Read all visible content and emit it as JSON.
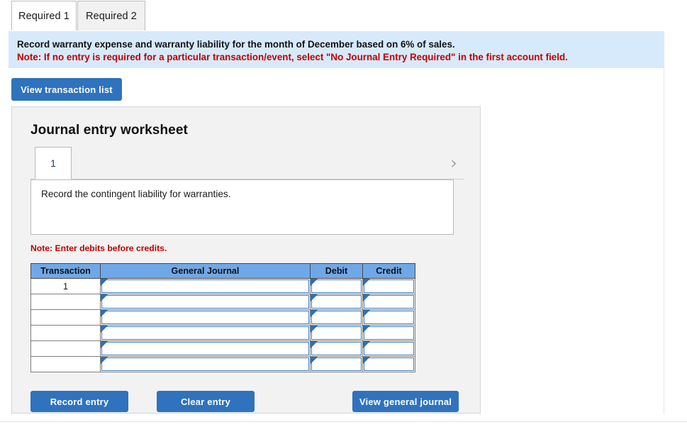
{
  "tabs": [
    {
      "label": "Required 1",
      "active": true
    },
    {
      "label": "Required 2",
      "active": false
    }
  ],
  "banner": {
    "instruction": "Record warranty expense and warranty liability for the month of December based on 6% of sales.",
    "note": "Note: If no entry is required for a particular transaction/event, select \"No Journal Entry Required\" in the first account field."
  },
  "toolbar": {
    "view_transaction_list_label": "View transaction list"
  },
  "worksheet": {
    "title": "Journal entry worksheet",
    "prev_icon": "chevron-left-icon",
    "next_icon": "chevron-right-icon",
    "pages": [
      {
        "label": "1",
        "active": true
      }
    ],
    "description": "Record the contingent liability for warranties.",
    "note": "Note: Enter debits before credits.",
    "table": {
      "headers": [
        "Transaction",
        "General Journal",
        "Debit",
        "Credit"
      ],
      "rows": [
        {
          "transaction": "1",
          "general_journal": "",
          "debit": "",
          "credit": ""
        },
        {
          "transaction": "",
          "general_journal": "",
          "debit": "",
          "credit": ""
        },
        {
          "transaction": "",
          "general_journal": "",
          "debit": "",
          "credit": ""
        },
        {
          "transaction": "",
          "general_journal": "",
          "debit": "",
          "credit": ""
        },
        {
          "transaction": "",
          "general_journal": "",
          "debit": "",
          "credit": ""
        },
        {
          "transaction": "",
          "general_journal": "",
          "debit": "",
          "credit": ""
        }
      ]
    },
    "actions": {
      "record_entry_label": "Record entry",
      "clear_entry_label": "Clear entry",
      "view_general_journal_label": "View general journal"
    }
  },
  "colors": {
    "button_blue": "#2f72bd",
    "table_header_blue": "#6fa8e8",
    "banner_blue": "#d7eafb",
    "note_red": "#c00000",
    "panel_gray": "#f2f2f2"
  }
}
